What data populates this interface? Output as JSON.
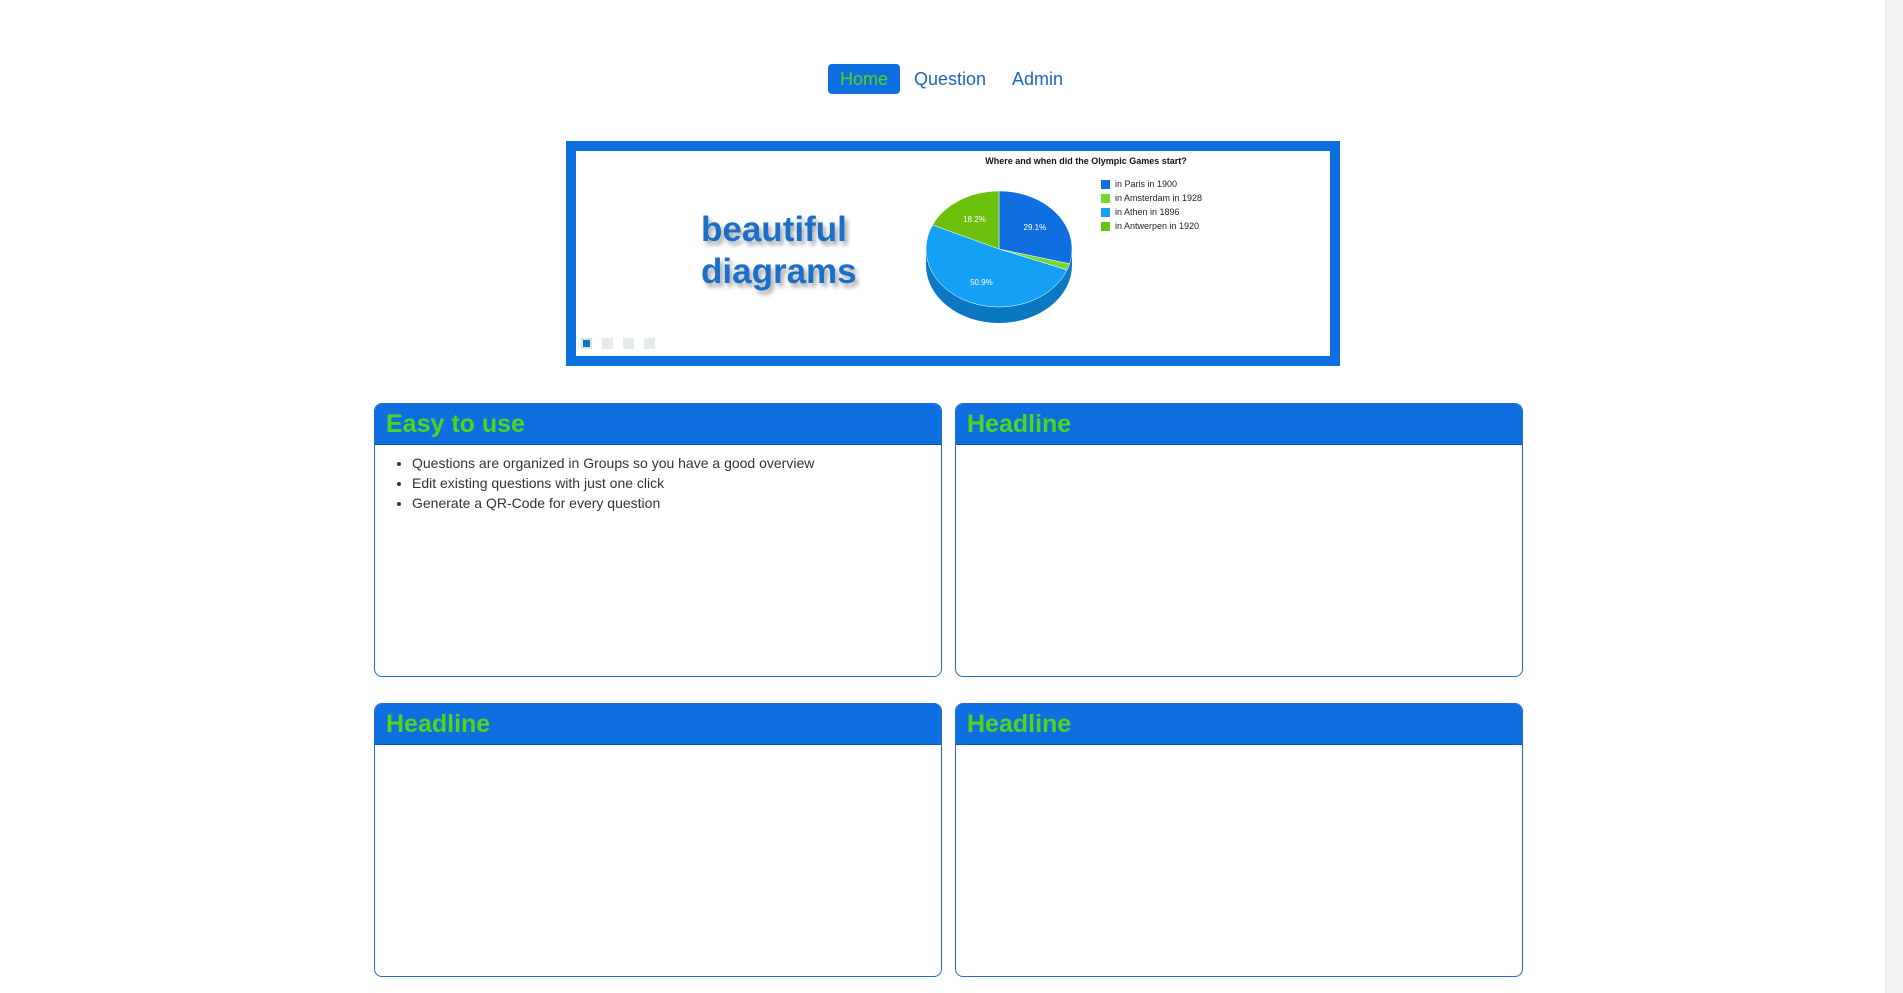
{
  "nav": {
    "items": [
      {
        "label": "Home",
        "active": true
      },
      {
        "label": "Question",
        "active": false
      },
      {
        "label": "Admin",
        "active": false
      }
    ]
  },
  "slider": {
    "caption_line1": "beautiful",
    "caption_line2": "diagrams",
    "dots": 4,
    "active_dot": 0
  },
  "chart_data": {
    "type": "pie",
    "title": "Where and when did the Olympic Games start?",
    "series": [
      {
        "name": "in Paris in 1900",
        "value": 29.1,
        "label": "29.1%",
        "color": "#0f6fe0"
      },
      {
        "name": "in Amsterdam in 1928",
        "value": 1.8,
        "label": "",
        "color": "#78d832"
      },
      {
        "name": "in Athen in 1896",
        "value": 50.9,
        "label": "50.9%",
        "color": "#14a0f5"
      },
      {
        "name": "in Antwerpen in 1920",
        "value": 18.2,
        "label": "18.2%",
        "color": "#6cc10c"
      }
    ],
    "legend_position": "right"
  },
  "panels": [
    {
      "title": "Easy to use",
      "items": [
        "Questions are organized in Groups so you have a good overview",
        "Edit existing questions with just one click",
        "Generate a QR-Code for every question"
      ]
    },
    {
      "title": "Headline",
      "items": []
    },
    {
      "title": "Headline",
      "items": []
    },
    {
      "title": "Headline",
      "items": []
    }
  ],
  "colors": {
    "brand_blue": "#0e6fe0",
    "brand_green": "#53d41c",
    "link_blue": "#1f63c3"
  }
}
